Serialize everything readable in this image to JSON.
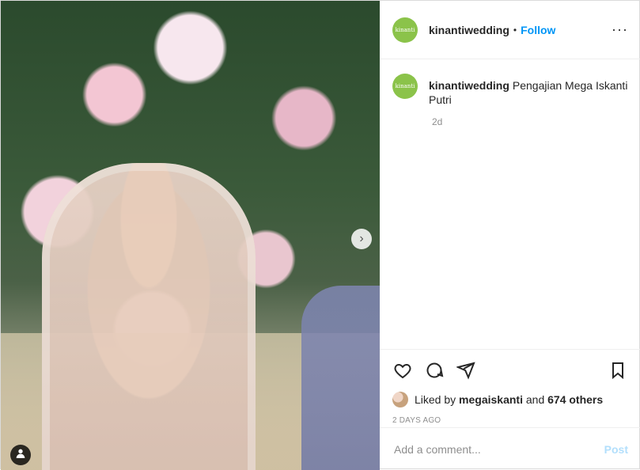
{
  "header": {
    "username": "kinantiwedding",
    "separator": "•",
    "follow_label": "Follow",
    "more_label": "···",
    "avatar_text": "kinanti"
  },
  "caption": {
    "username": "kinantiwedding",
    "text": "Pengajian Mega Iskanti Putri",
    "time_ago": "2d"
  },
  "likes": {
    "prefix": "Liked by",
    "user": "megaiskanti",
    "connector": "and",
    "others": "674 others"
  },
  "post_date": "2 DAYS AGO",
  "comment": {
    "placeholder": "Add a comment...",
    "post_label": "Post"
  },
  "icons": [
    "heart-icon",
    "comment-icon",
    "share-icon",
    "bookmark-icon",
    "user-tag-icon",
    "next-arrow-icon"
  ],
  "colors": {
    "accent_blue": "#0095f6",
    "post_disabled": "#b2dffc",
    "avatar_green": "#8bc34a",
    "muted_text": "#8e8e8e"
  }
}
